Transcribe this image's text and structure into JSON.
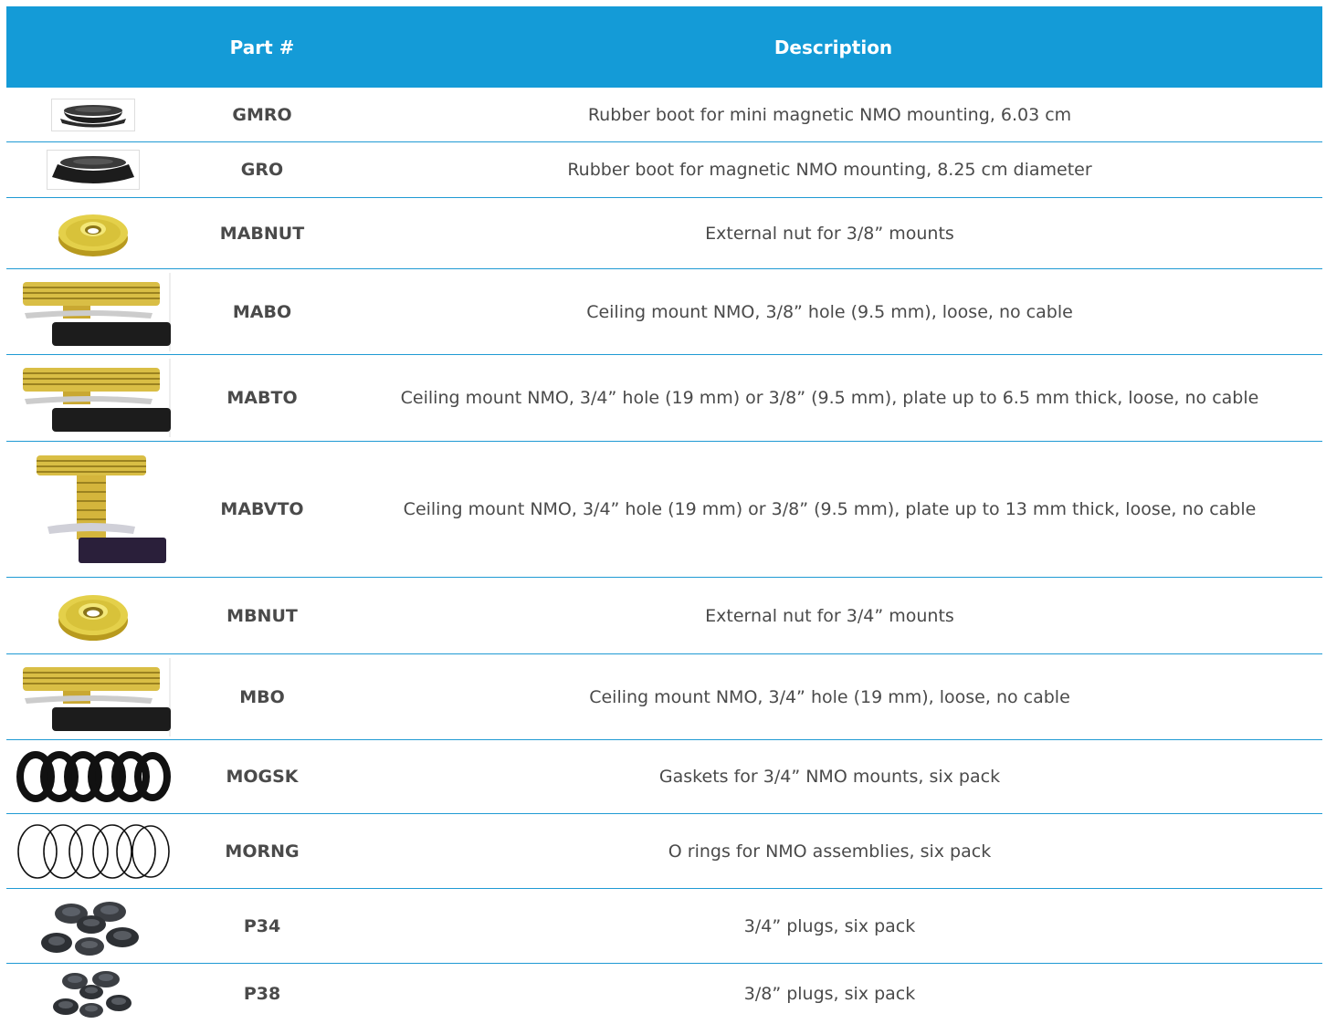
{
  "header": {
    "part_label": "Part #",
    "description_label": "Description"
  },
  "rows": [
    {
      "part": "GMRO",
      "description": "Rubber boot for mini magnetic NMO mounting, 6.03 cm",
      "icon": "rubber-boot-icon"
    },
    {
      "part": "GRO",
      "description": "Rubber boot for magnetic NMO mounting, 8.25 cm diameter",
      "icon": "rubber-boot-icon"
    },
    {
      "part": "MABNUT",
      "description": "External nut for 3/8” mounts",
      "icon": "brass-nut-icon"
    },
    {
      "part": "MABO",
      "description": "Ceiling mount NMO, 3/8” hole (9.5 mm), loose, no cable",
      "icon": "ceiling-mount-icon"
    },
    {
      "part": "MABTO",
      "description": "Ceiling mount NMO, 3/4” hole (19 mm) or 3/8” (9.5 mm), plate up to 6.5 mm thick, loose, no cable",
      "icon": "ceiling-mount-icon"
    },
    {
      "part": "MABVTO",
      "description": "Ceiling mount NMO, 3/4” hole (19 mm) or 3/8” (9.5 mm), plate up to 13 mm thick, loose, no cable",
      "icon": "tall-ceiling-mount-icon"
    },
    {
      "part": "MBNUT",
      "description": "External nut for 3/4” mounts",
      "icon": "brass-nut-icon"
    },
    {
      "part": "MBO",
      "description": "Ceiling mount NMO, 3/4” hole (19 mm), loose, no cable",
      "icon": "ceiling-mount-icon"
    },
    {
      "part": "MOGSK",
      "description": "Gaskets for 3/4” NMO mounts, six pack",
      "icon": "gaskets-icon"
    },
    {
      "part": "MORNG",
      "description": "O rings for NMO assemblies, six pack",
      "icon": "o-rings-icon"
    },
    {
      "part": "P34",
      "description": "3/4” plugs, six pack",
      "icon": "plugs-icon"
    },
    {
      "part": "P38",
      "description": "3/8” plugs, six pack",
      "icon": "plugs-icon"
    }
  ],
  "colors": {
    "header_bg": "#149bd7",
    "divider": "#1f9ad4",
    "text": "#4a4a4a"
  }
}
